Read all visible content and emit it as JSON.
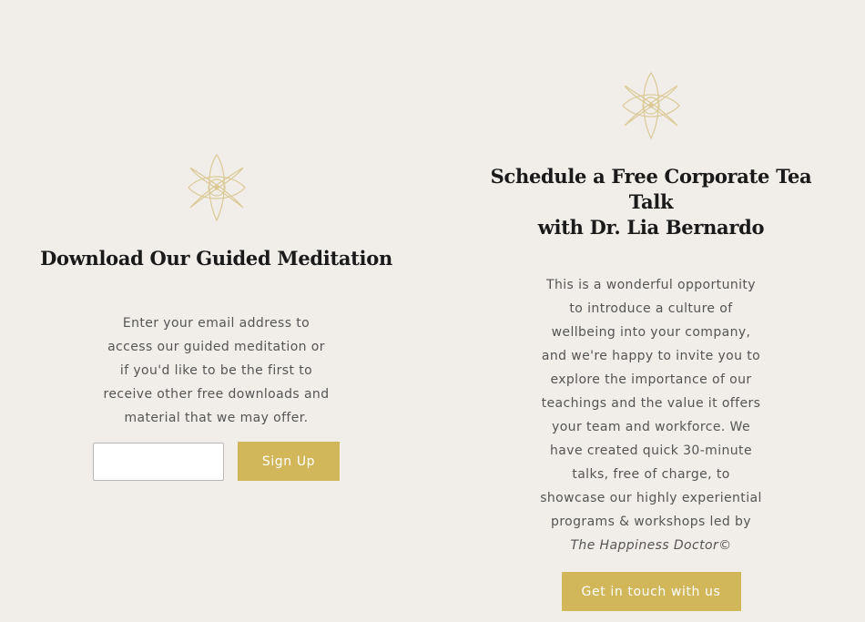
{
  "left": {
    "title": "Download Our Guided Meditation",
    "description": "Enter your email address to access our guided meditation or if you'd like to be the first to receive other free downloads and material that we may offer.",
    "email_placeholder": "",
    "signup_label": "Sign Up",
    "icon": "lotus-icon"
  },
  "right": {
    "title_line1": "Schedule a Free Corporate Tea Talk",
    "title_line2": "with Dr. Lia Bernardo",
    "description": "This is a wonderful opportunity to introduce a culture of wellbeing into your company, and we're happy to invite you to explore the importance of our teachings and the value it offers your team and workforce. We have created quick 30-minute talks, free of charge, to showcase our highly experiential programs & workshops led by ",
    "description_brand": "The Happiness Doctor©",
    "cta_label": "Get in touch with us",
    "icon": "lotus-icon"
  },
  "colors": {
    "background": "#f1eeea",
    "accent": "#d1b65a",
    "icon_stroke": "#dcc996",
    "heading": "#1a1a1a"
  }
}
